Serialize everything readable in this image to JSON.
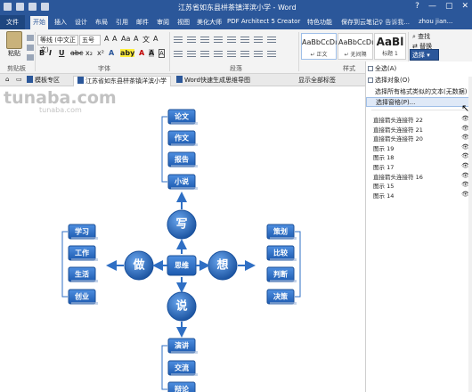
{
  "window": {
    "title": "江苏省如东县栟茶镇洋滨小学 - Word",
    "controls": [
      "?",
      "—",
      "▢",
      "✕"
    ]
  },
  "ribbon_tabs": [
    "文件",
    "开始",
    "插入",
    "设计",
    "布局",
    "引用",
    "邮件",
    "审阅",
    "视图",
    "美化大师",
    "PDF Architect 5 Creator",
    "特色功能",
    "保存到云笔记"
  ],
  "tell_me": "♀ 告诉我...",
  "user": "zhou jian...",
  "home": {
    "paste_label": "粘贴",
    "font_name": "等线 (中文正文)",
    "font_size": "五号",
    "format_row1": [
      "B",
      "I",
      "U",
      "abc",
      "x₂",
      "x²",
      "A"
    ],
    "format_row2": [
      "A",
      "aby",
      "A",
      "A",
      "A"
    ],
    "styles": [
      {
        "preview": "AaBbCcDı",
        "name": "↵ 正文"
      },
      {
        "preview": "AaBbCcDı",
        "name": "↵ 无间隔"
      },
      {
        "preview": "AaBl",
        "name": "标题 1"
      }
    ],
    "find": "查找",
    "replace": "替换",
    "select": "选择 ▾",
    "groups": {
      "clipboard": "剪贴板",
      "font": "字体",
      "paragraph": "段落",
      "styles": "样式"
    }
  },
  "doc_tabs": [
    "模板专区",
    "江苏省如东县栟茶镇洋滨小学",
    "Word快速生成思维导图",
    "显示全部标签"
  ],
  "watermark": {
    "line1": "tunaba.com",
    "line2": "tunaba.com"
  },
  "mindmap": {
    "center": "思维",
    "hubs": {
      "top": "写",
      "left": "做",
      "right": "想",
      "bottom": "说"
    },
    "top_items": [
      "论文",
      "作文",
      "报告",
      "小说"
    ],
    "left_items": [
      "学习",
      "工作",
      "生活",
      "创业"
    ],
    "right_items": [
      "策划",
      "比较",
      "判断",
      "决策"
    ],
    "bottom_items": [
      "演讲",
      "交流",
      "辩论"
    ]
  },
  "select_menu": {
    "items": [
      "全选(A)",
      "选择对象(O)",
      "选择所有格式类似的文本(无数据)",
      "选择窗格(P)..."
    ],
    "highlighted_index": 3,
    "pane_items": [
      "直接箭头连接符 22",
      "直接箭头连接符 21",
      "直接箭头连接符 20",
      "图示 19",
      "图示 18",
      "图示 17",
      "直接箭头连接符 16",
      "图示 15",
      "图示 14"
    ]
  },
  "colors": {
    "accent": "#2b579a",
    "node_blue": "#2f6fc4",
    "node_border": "#1b4f97"
  }
}
